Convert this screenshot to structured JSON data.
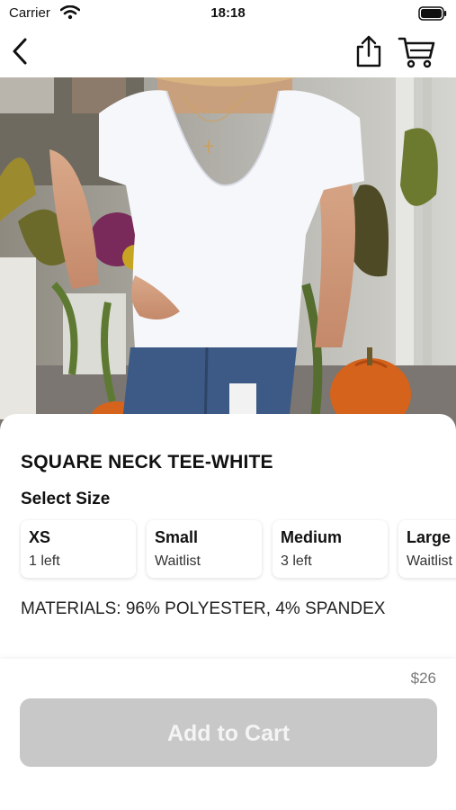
{
  "status_bar": {
    "carrier": "Carrier",
    "time": "18:18"
  },
  "product": {
    "title": "SQUARE NECK TEE-WHITE",
    "select_size_label": "Select Size",
    "sizes": [
      {
        "name": "XS",
        "stock": "1 left"
      },
      {
        "name": "Small",
        "stock": "Waitlist"
      },
      {
        "name": "Medium",
        "stock": "3 left"
      },
      {
        "name": "Large",
        "stock": "Waitlist"
      }
    ],
    "materials": "MATERIALS: 96% POLYESTER, 4% SPANDEX",
    "price": "$26"
  },
  "footer": {
    "add_to_cart_label": "Add to Cart"
  },
  "icons": {
    "back": "chevron-left-icon",
    "share": "share-icon",
    "cart": "cart-icon"
  },
  "colors": {
    "button_disabled": "#c8c8c8",
    "price_text": "#777777"
  }
}
